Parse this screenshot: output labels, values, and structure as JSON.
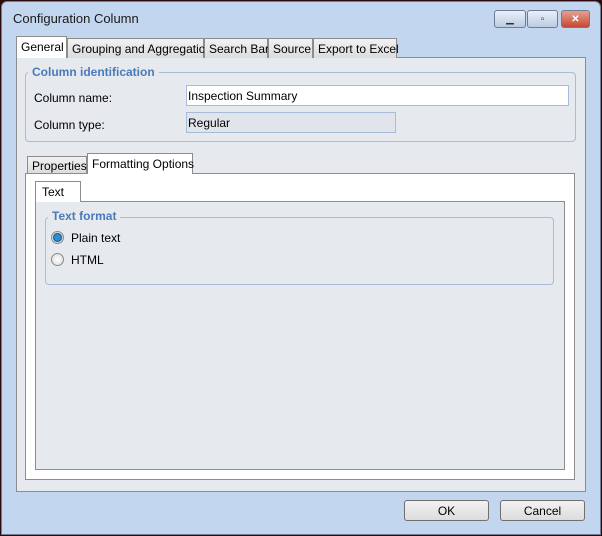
{
  "window": {
    "title": "Configuration Column",
    "minimize_icon": "minimize-icon",
    "maximize_icon": "maximize-icon",
    "close_icon": "close-icon"
  },
  "tabs": [
    {
      "label": "General",
      "active": true
    },
    {
      "label": "Grouping and Aggregation"
    },
    {
      "label": "Search Bar"
    },
    {
      "label": "Source"
    },
    {
      "label": "Export to Excel"
    }
  ],
  "column_identification": {
    "legend": "Column identification",
    "name_label": "Column name:",
    "name_value": "Inspection Summary",
    "type_label": "Column type:",
    "type_value": "Regular"
  },
  "subtabs": [
    {
      "label": "Properties"
    },
    {
      "label": "Formatting Options",
      "active": true
    }
  ],
  "formatting": {
    "tab": "Text",
    "legend": "Text format",
    "options": [
      {
        "label": "Plain text",
        "selected": true
      },
      {
        "label": "HTML",
        "selected": false
      }
    ]
  },
  "buttons": {
    "ok": "OK",
    "cancel": "Cancel"
  }
}
